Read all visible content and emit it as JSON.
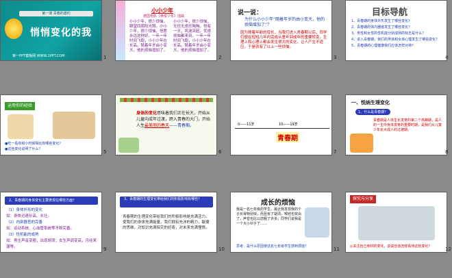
{
  "slides": [
    {
      "num": "1",
      "lesson": "第一课 青春的邀约",
      "title": "悄悄变化的我",
      "footer": "第一PPT模板网 WWW.1PPT.COM"
    },
    {
      "num": "2",
      "title": "小小少年",
      "subtitle": "德国电影《英俊少年》插曲",
      "col1": "小小少年，很少烦恼，眼望四周阳光照。小小少年，很少烦恼，但愿永远这样好。一年一年时间飞跑，小小少年在长高。随着年岁由小变大，他的烦恼增加了。",
      "col2": "小小少年，很少烦恼，无忧无虑乐陶陶。但有一天，风波突起，忧虑烦恼都来到。一年一年时间飞跑，小小少年在长高。随着年岁由小变大，他的烦恼增加了。"
    },
    {
      "num": "3",
      "title": "说一说：",
      "question": "为什么小小少年“随着年岁的由小变大，他的烦恼增加了”？",
      "answer": "因为随着年龄的增长，当我们进入青春期以后，同学们便在短短几年内完成从童年到成年的重要转变。生理上和心理上都会发生很大的变化，让人产生不适应，于是就有了以上一些烦恼。"
    },
    {
      "num": "4",
      "title": "目标导航",
      "items": [
        "1、青春期的身体外形发生了哪些变化？",
        "2、青春期的体内器官发生了哪些变化？",
        "3、男性和女性的性机能分别成熟的标志是什么？",
        "4、进入青春期，我们的男孩和女孩心理发生了哪些变化？",
        "5、青春期的心理健康我们应该怎样对待？"
      ]
    },
    {
      "num": "5",
      "title": "运用你的经验",
      "q1": "●吃一看你和小时候相比有哪些变化？",
      "q2": "●这些变化说明了什么？"
    },
    {
      "num": "6",
      "text1": "身体的变化",
      "text2": "意味着我们正在长大，开始从儿童向成年过渡，跨入青春的大门，开始人生",
      "text3": "最美丽的春天",
      "text4": "——青春期。"
    },
    {
      "num": "7",
      "label1": "0——11岁",
      "label2": "10——19岁",
      "center": "青春期"
    },
    {
      "num": "8",
      "section": "一、悦纳生理变化",
      "q": "1、什么是青春期？",
      "a": "青春期是人体生长发育的第二个高峰期，是人的一生中身体发育的重要时期，是我们从儿童少年长大成人的过渡期。"
    },
    {
      "num": "9",
      "header": "2、青春期的身体变化主要表现在哪些方面？",
      "items": [
        "（1）身体外形的变化",
        "如：身体迅速长高、长壮。",
        "（2）内部器官的完善",
        "如：运动系统、心血管系统等不断完善。",
        "（3）性机能的成熟",
        "如：男生声音变粗，出现胡须；女生声调变高，月经来潮等。"
      ]
    },
    {
      "num": "10",
      "header": "3、青春期的生理变化带给我们的积极影响有哪些？",
      "body": "青春期的生理变化带给我们的积极影响是充满活力。使我们的身体充满能量，我们拥有充沛的精力，敏捷的思维，对知识充满探究的好奇，对未来充满憧憬。"
    },
    {
      "num": "11",
      "title": "成长的烦恼",
      "body": "我是一名七年级的学生，最近我发现我的个子长得特别快，而且有了胡须，喉结也突出了，声音也比以前粗了许多，同学们说我是一个大小伙子了……",
      "think": "思考：是什么原因使这名七年级学生感到烦恼？"
    },
    {
      "num": "12",
      "title": "探究与分享",
      "q": "◎关注自己身材的变化，说说应该怎样看待这些变化？"
    }
  ]
}
